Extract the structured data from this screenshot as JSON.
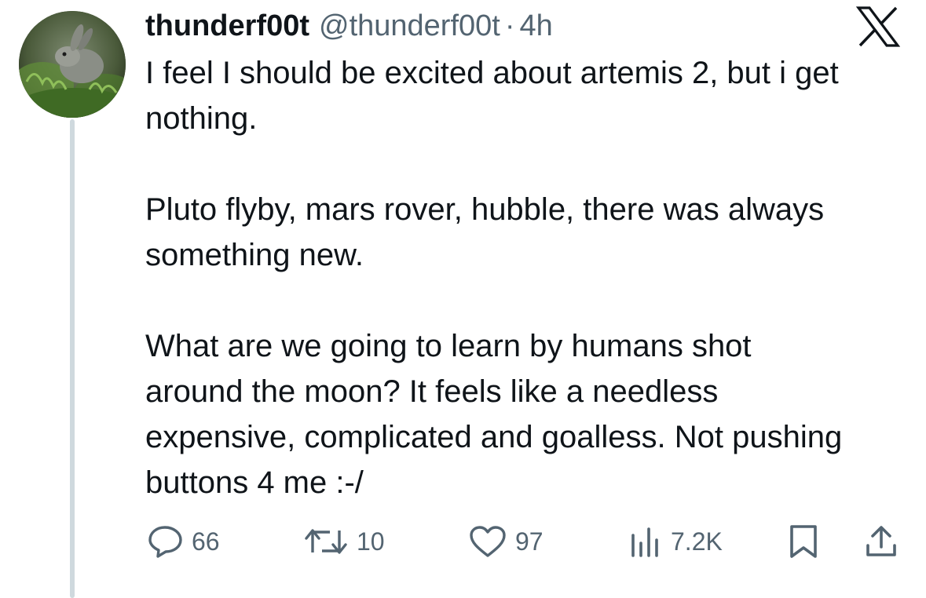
{
  "tweet": {
    "display_name": "thunderf00t",
    "handle": "@thunderf00t",
    "separator": "·",
    "time": "4h",
    "paragraphs": [
      "I feel I should be excited about artemis 2, but i get nothing.",
      "Pluto flyby, mars rover, hubble, there was always something new.",
      "What are we going to learn by humans shot around the moon? It feels like a needless expensive, complicated and goalless. Not pushing buttons 4 me :-/"
    ]
  },
  "actions": {
    "replies": "66",
    "reposts": "10",
    "likes": "97",
    "views": "7.2K"
  },
  "icons": {
    "brand": "x-logo-icon",
    "reply": "reply-icon",
    "repost": "repost-icon",
    "like": "heart-icon",
    "views": "views-icon",
    "bookmark": "bookmark-icon",
    "share": "share-icon"
  },
  "colors": {
    "text": "#0f1419",
    "secondary": "#536471",
    "thread_line": "#cfd9de"
  }
}
